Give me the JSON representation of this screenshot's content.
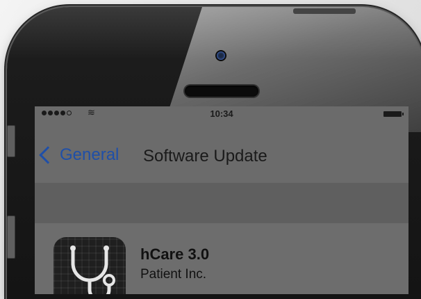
{
  "status_bar": {
    "time": "10:34",
    "signal_bars": 4,
    "signal_total": 5
  },
  "nav": {
    "back_label": "General",
    "title": "Software Update"
  },
  "update": {
    "app_name": "hCare 3.0",
    "company": "Patient Inc.",
    "icon": "stethoscope-icon"
  },
  "colors": {
    "accent": "#1f4fa8",
    "screen": "#6b6b6b"
  }
}
